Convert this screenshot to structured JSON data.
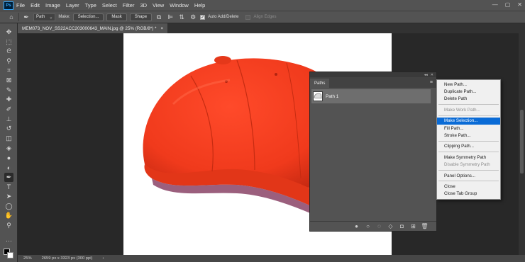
{
  "menubar": {
    "app_logo": "Ps",
    "items": [
      "File",
      "Edit",
      "Image",
      "Layer",
      "Type",
      "Select",
      "Filter",
      "3D",
      "View",
      "Window",
      "Help"
    ],
    "window_controls": [
      "—",
      "▢",
      "✕"
    ]
  },
  "options_bar": {
    "mode_value": "Path",
    "make_label": "Make:",
    "selection_button": "Selection...",
    "mask_button": "Mask",
    "shape_button": "Shape",
    "auto_add_delete_label": "Auto Add/Delete",
    "auto_add_delete_checked": true,
    "align_edges_label": "Align Edges"
  },
  "document_tab": {
    "title": "MEM073_NOV_SS22ACC203000643_MAIN.jpg @ 25% (RGB/8*) *",
    "close": "×"
  },
  "toolbar": {
    "tools": [
      {
        "name": "move-tool",
        "glyph": "✥"
      },
      {
        "name": "marquee-tool",
        "glyph": "⬚"
      },
      {
        "name": "lasso-tool",
        "glyph": "ᘓ"
      },
      {
        "name": "quick-selection-tool",
        "glyph": "⚲"
      },
      {
        "name": "crop-tool",
        "glyph": "⌗"
      },
      {
        "name": "frame-tool",
        "glyph": "⊠"
      },
      {
        "name": "eyedropper-tool",
        "glyph": "✎"
      },
      {
        "name": "healing-brush-tool",
        "glyph": "✚"
      },
      {
        "name": "brush-tool",
        "glyph": "✐"
      },
      {
        "name": "clone-stamp-tool",
        "glyph": "⊥"
      },
      {
        "name": "history-brush-tool",
        "glyph": "↺"
      },
      {
        "name": "eraser-tool",
        "glyph": "◫"
      },
      {
        "name": "paint-bucket-tool",
        "glyph": "◈"
      },
      {
        "name": "blur-tool",
        "glyph": "●"
      },
      {
        "name": "dodge-tool",
        "glyph": "◐"
      },
      {
        "name": "pen-tool",
        "glyph": "✒"
      },
      {
        "name": "type-tool",
        "glyph": "T"
      },
      {
        "name": "path-selection-tool",
        "glyph": "➤"
      },
      {
        "name": "ellipse-tool",
        "glyph": "◯"
      },
      {
        "name": "hand-tool",
        "glyph": "✋"
      },
      {
        "name": "zoom-tool",
        "glyph": "⚲"
      },
      {
        "name": "more-tools",
        "glyph": "···"
      }
    ]
  },
  "status_bar": {
    "zoom": "25%",
    "dimensions": "2659 px x 3323 px (300 ppi)",
    "arrow": "›"
  },
  "paths_panel": {
    "collapse_icons": [
      "◂◂",
      "✕"
    ],
    "tab_label": "Paths",
    "menu_icon": "≡",
    "rows": [
      {
        "label": "Path 1"
      }
    ],
    "footer_icons": [
      {
        "name": "fill-path-icon",
        "glyph": "●"
      },
      {
        "name": "stroke-path-icon",
        "glyph": "○"
      },
      {
        "name": "load-as-selection-icon",
        "glyph": "◌"
      },
      {
        "name": "make-work-path-icon",
        "glyph": "◇"
      },
      {
        "name": "add-mask-icon",
        "glyph": "◘"
      },
      {
        "name": "new-path-icon",
        "glyph": "⊞"
      },
      {
        "name": "delete-path-icon",
        "glyph": "🗑"
      }
    ]
  },
  "flyout_menu": {
    "groups": [
      [
        {
          "label": "New Path...",
          "state": "normal"
        },
        {
          "label": "Duplicate Path...",
          "state": "normal"
        },
        {
          "label": "Delete Path",
          "state": "normal"
        }
      ],
      [
        {
          "label": "Make Work Path...",
          "state": "disabled"
        }
      ],
      [
        {
          "label": "Make Selection...",
          "state": "selected"
        },
        {
          "label": "Fill Path...",
          "state": "normal"
        },
        {
          "label": "Stroke Path...",
          "state": "normal"
        }
      ],
      [
        {
          "label": "Clipping Path...",
          "state": "normal"
        }
      ],
      [
        {
          "label": "Make Symmetry Path",
          "state": "normal"
        },
        {
          "label": "Disable Symmetry Path",
          "state": "disabled"
        }
      ],
      [
        {
          "label": "Panel Options...",
          "state": "normal"
        }
      ],
      [
        {
          "label": "Close",
          "state": "normal"
        },
        {
          "label": "Close Tab Group",
          "state": "normal"
        }
      ]
    ]
  },
  "colors": {
    "cap": "#f43b1c",
    "cap_shadow": "#c82a12",
    "selection_highlight": "#0a6bd6"
  }
}
